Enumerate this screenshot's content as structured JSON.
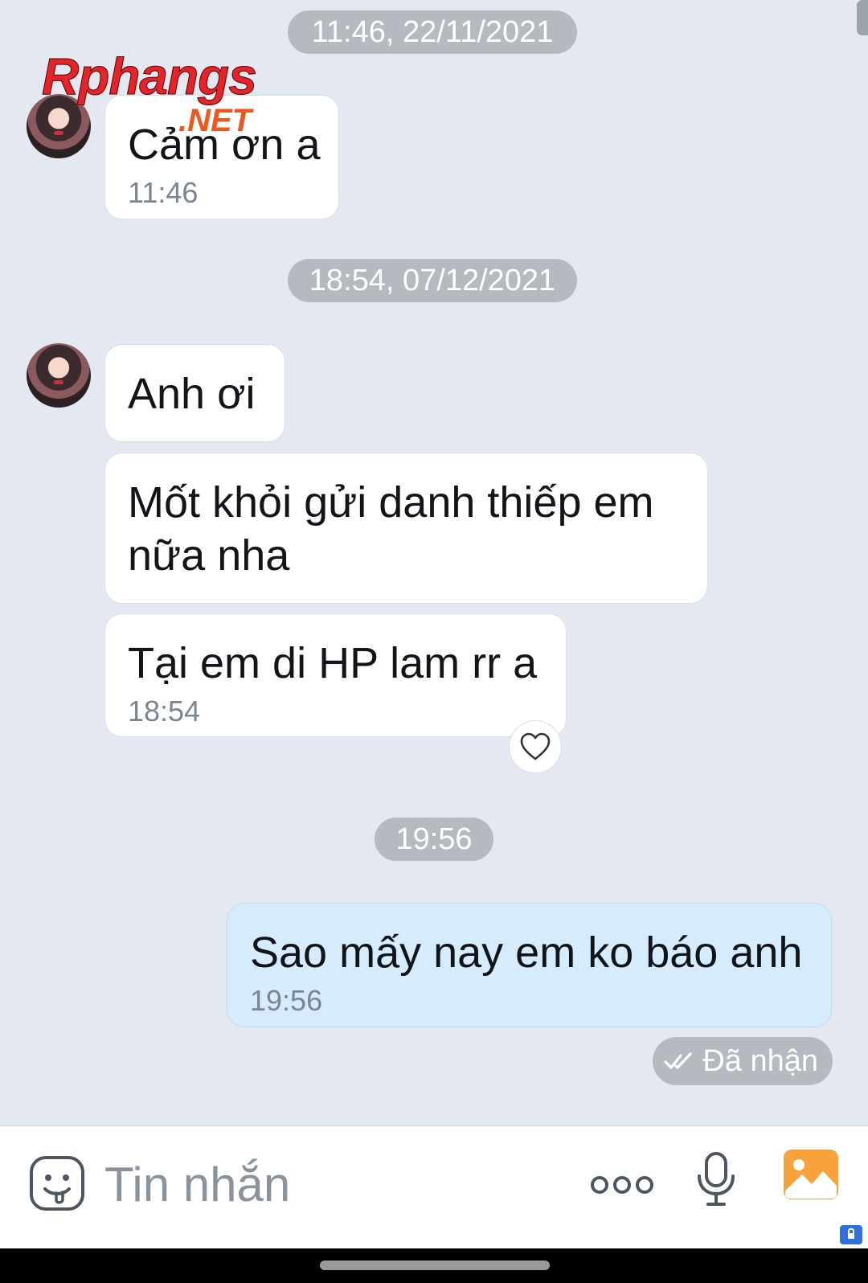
{
  "watermark": {
    "main": "Rphangs",
    "sub": ".NET"
  },
  "timestamps": {
    "first": "11:46, 22/11/2021",
    "second": "18:54, 07/12/2021",
    "third": "19:56"
  },
  "messages": [
    {
      "text": "Cảm ơn a",
      "time": "11:46"
    },
    {
      "text": "Anh ơi"
    },
    {
      "line1": "Mốt khỏi gửi danh thiếp em",
      "line2": "nữa nha"
    },
    {
      "text": "Tại em di HP lam rr a",
      "time": "18:54"
    },
    {
      "text": "Sao mấy nay em ko báo anh",
      "time": "19:56"
    }
  ],
  "status": {
    "label": "Đã nhận"
  },
  "composer": {
    "placeholder": "Tin nhắn"
  },
  "colors": {
    "chat_bg": "#e4e9f1",
    "incoming_bubble": "#ffffff",
    "outgoing_bubble": "#d6ecfd",
    "timestamp_pill": "#b5bac1",
    "image_button": "#f7a23b"
  },
  "icons": {
    "reaction": "heart-icon",
    "status": "double-check-icon",
    "emoji": "sticker-icon",
    "more": "more-dots-icon",
    "mic": "microphone-icon",
    "image": "image-icon"
  }
}
